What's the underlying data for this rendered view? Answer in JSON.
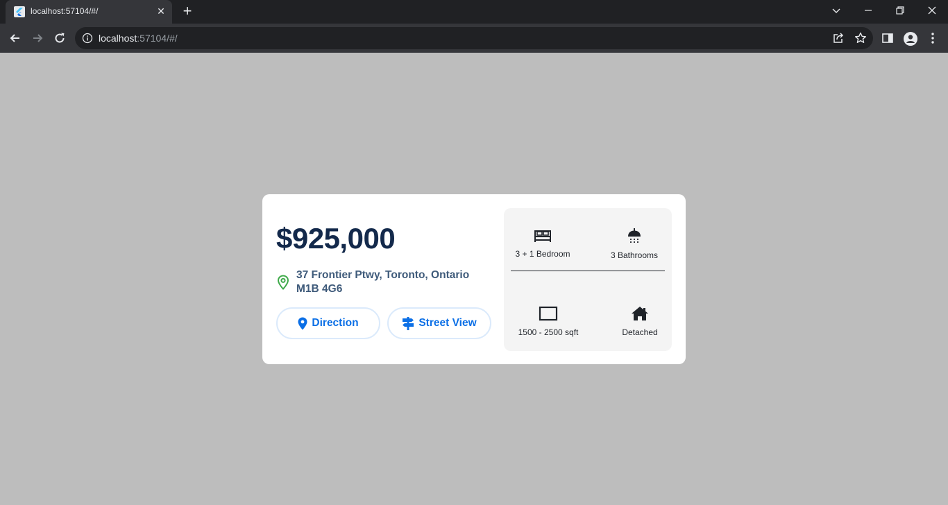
{
  "browser": {
    "tab_title": "localhost:57104/#/",
    "tab_close": "✕",
    "new_tab": "+",
    "url_host": "localhost",
    "url_rest": ":57104/#/"
  },
  "listing": {
    "price": "$925,000",
    "address": "37 Frontier Ptwy, Toronto, Ontario M1B 4G6",
    "direction_label": "Direction",
    "street_view_label": "Street View",
    "bedrooms": "3 + 1 Bedroom",
    "bathrooms": "3 Bathrooms",
    "area": "1500 - 2500 sqft",
    "type": "Detached"
  },
  "colors": {
    "page_background": "#bdbdbd",
    "price": "#13294b",
    "address": "#3e5a7a",
    "button_text": "#0b6fe6",
    "pin": "#3faa4a"
  }
}
